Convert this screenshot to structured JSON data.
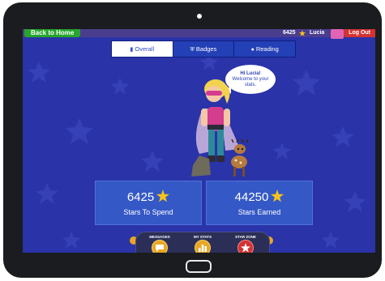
{
  "top_bar": {
    "back_label": "Back to Home",
    "star_count": "6425",
    "user_name": "Lucia",
    "logout_label": "Log Out"
  },
  "tabs": [
    {
      "label": "Overall",
      "icon": "bar-chart-icon",
      "active": true
    },
    {
      "label": "Badges",
      "icon": "shield-icon",
      "active": false
    },
    {
      "label": "Reading",
      "icon": "book-icon",
      "active": false
    }
  ],
  "speech_bubble": {
    "title": "Hi Lucia!",
    "line1": "Welcome to your",
    "line2": "stats."
  },
  "cards": {
    "spend": {
      "value": "6425",
      "label": "Stars To Spend"
    },
    "earned": {
      "value": "44250",
      "label": "Stars Earned"
    }
  },
  "bottom_nav": [
    {
      "label": "MESSAGES",
      "icon": "chat-icon"
    },
    {
      "label": "MY STATS",
      "icon": "bar-chart-icon"
    },
    {
      "label": "STAR ZONE",
      "icon": "star-icon"
    }
  ],
  "colors": {
    "background": "#2a33a8",
    "card": "#3458c6",
    "star": "#f6c21c",
    "back_button": "#27a62d",
    "logout_button": "#d33232"
  }
}
